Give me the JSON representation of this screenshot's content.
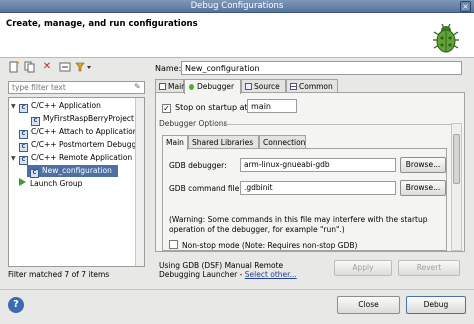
{
  "window": {
    "title": "Debug Configurations"
  },
  "header": {
    "title": "Create, manage, and run configurations"
  },
  "toolbar": {
    "icons": [
      "new-config-icon",
      "duplicate-icon",
      "delete-icon",
      "collapse-all-icon",
      "filter-dropdown-icon"
    ]
  },
  "filter": {
    "placeholder": "type filter text"
  },
  "tree": {
    "items": [
      {
        "label": "C/C++ Application",
        "level": 0,
        "expanded": true
      },
      {
        "label": "MyFirstRaspBerryProject",
        "level": 1
      },
      {
        "label": "C/C++ Attach to Application",
        "level": 0
      },
      {
        "label": "C/C++ Postmortem Debugger",
        "level": 0
      },
      {
        "label": "C/C++ Remote Application",
        "level": 0,
        "expanded": true
      },
      {
        "label": "New_configuration",
        "level": 1,
        "selected": true
      },
      {
        "label": "Launch Group",
        "level": 0
      }
    ]
  },
  "filter_status": "Filter matched 7 of 7 items",
  "config": {
    "name_label": "Name:",
    "name_value": "New_configuration",
    "tabs": [
      "Main",
      "Debugger",
      "Source",
      "Common"
    ],
    "active_tab": "Debugger",
    "stop_on_startup_label": "Stop on startup at:",
    "stop_on_startup_value": "main",
    "stop_on_startup_checked": true,
    "debugger_options_label": "Debugger Options",
    "inner_tabs": [
      "Main",
      "Shared Libraries",
      "Connection"
    ],
    "active_inner_tab": "Main",
    "gdb_debugger_label": "GDB debugger:",
    "gdb_debugger_value": "arm-linux-gnueabi-gdb",
    "gdb_command_label": "GDB command file:",
    "gdb_command_value": ".gdbinit",
    "browse_label": "Browse...",
    "warning_text": "(Warning: Some commands in this file may interfere with the startup operation of the debugger, for example \"run\".)",
    "non_stop_label": "Non-stop mode (Note: Requires non-stop GDB)"
  },
  "launcher": {
    "prefix": "Using GDB (DSF) Manual Remote Debugging Launcher - ",
    "link": "Select other..."
  },
  "buttons": {
    "apply": "Apply",
    "revert": "Revert",
    "close": "Close",
    "debug": "Debug"
  },
  "colors": {
    "selection": "#4d6fa3",
    "title_bar": "#56739e",
    "link": "#23408f"
  }
}
